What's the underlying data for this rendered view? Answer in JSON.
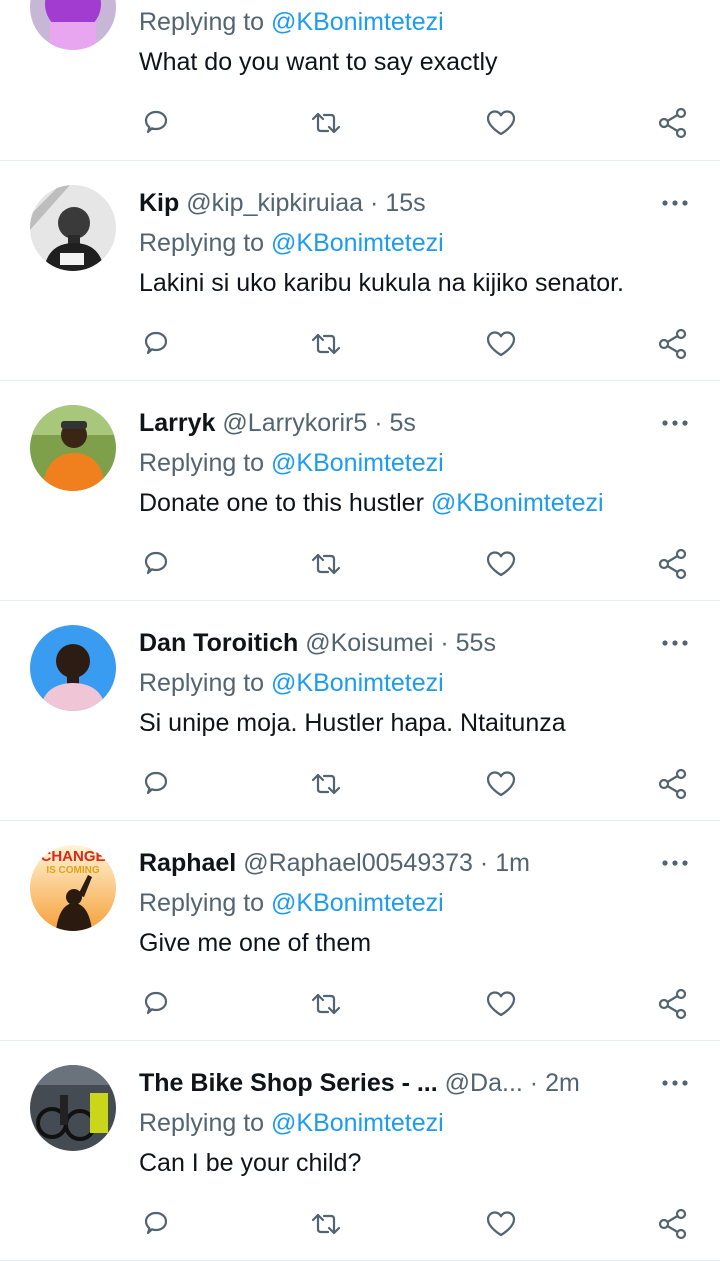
{
  "replying_label": "Replying to",
  "tweets": [
    {
      "name": "",
      "handle": "",
      "time": "",
      "reply_to": "@KBonimtetezi",
      "text": "What do you want to say exactly",
      "mention": "",
      "avatar_colors": [
        "#a23bd0",
        "#e9a6f0"
      ]
    },
    {
      "name": "Kip",
      "handle": "@kip_kipkiruiaa",
      "time": "15s",
      "reply_to": "@KBonimtetezi",
      "text": "Lakini si uko karibu kukula na kijiko senator.",
      "mention": "",
      "avatar_colors": [
        "#d9d9d9",
        "#3a3a3a"
      ]
    },
    {
      "name": "Larryk",
      "handle": "@Larrykorir5",
      "time": "5s",
      "reply_to": "@KBonimtetezi",
      "text": "Donate one to this hustler ",
      "mention": "@KBonimtetezi",
      "avatar_colors": [
        "#6b8e3a",
        "#f07f1e"
      ]
    },
    {
      "name": "Dan Toroitich",
      "handle": "@Koisumei",
      "time": "55s",
      "reply_to": "@KBonimtetezi",
      "text": "Si unipe moja. Hustler hapa. Ntaitunza",
      "mention": "",
      "avatar_colors": [
        "#3a9cf0",
        "#2d1c14"
      ]
    },
    {
      "name": "Raphael",
      "handle": "@Raphael00549373",
      "time": "1m",
      "reply_to": "@KBonimtetezi",
      "text": "Give me one of them",
      "mention": "",
      "avatar_colors": [
        "#f5b04a",
        "#2b1a10"
      ],
      "avatar_text": [
        "CHANGE",
        "IS COMING"
      ]
    },
    {
      "name": "The Bike Shop Series - ...",
      "handle": "@Da...",
      "time": "2m",
      "reply_to": "@KBonimtetezi",
      "text": "Can I be your child?",
      "mention": "",
      "avatar_colors": [
        "#444b52",
        "#c9d61a"
      ]
    }
  ]
}
